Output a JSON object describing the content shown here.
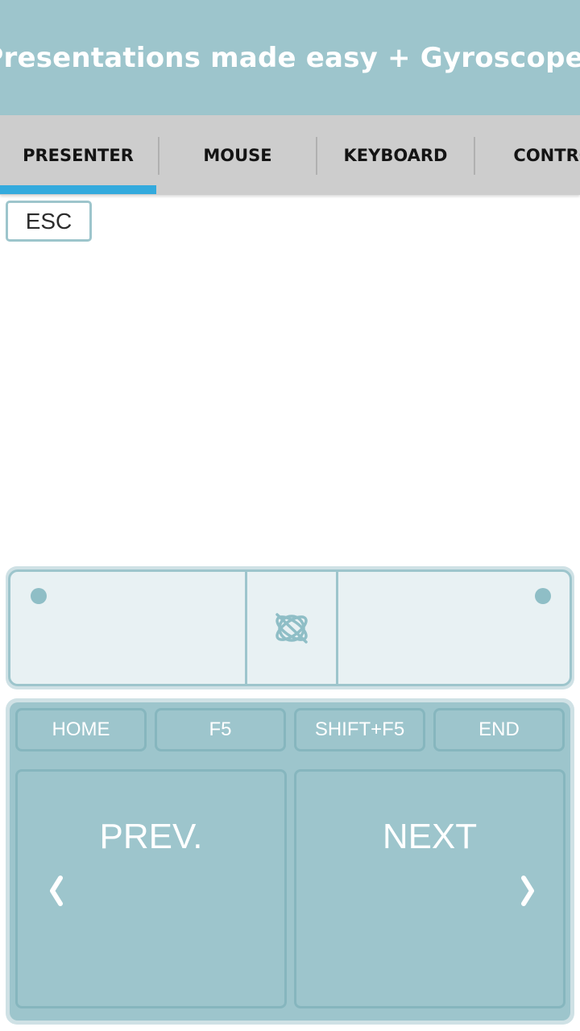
{
  "header": {
    "title": "Presentations made easy + Gyroscope!"
  },
  "tabs": [
    {
      "label": "PRESENTER",
      "selected": true
    },
    {
      "label": "MOUSE",
      "selected": false
    },
    {
      "label": "KEYBOARD",
      "selected": false
    },
    {
      "label": "CONTRO",
      "selected": false
    }
  ],
  "presenter": {
    "esc_label": "ESC",
    "gyro_icon": "gyroscope-disabled-icon",
    "keys": {
      "home": "HOME",
      "f5": "F5",
      "shift_f5": "SHIFT+F5",
      "end": "END"
    },
    "prev_label": "PREV.",
    "next_label": "NEXT"
  },
  "colors": {
    "primary": "#9dc5cc",
    "tab_bar": "#cdcdcd",
    "tab_indicator": "#33aadd",
    "touchpad_fill": "#e8f1f3"
  }
}
